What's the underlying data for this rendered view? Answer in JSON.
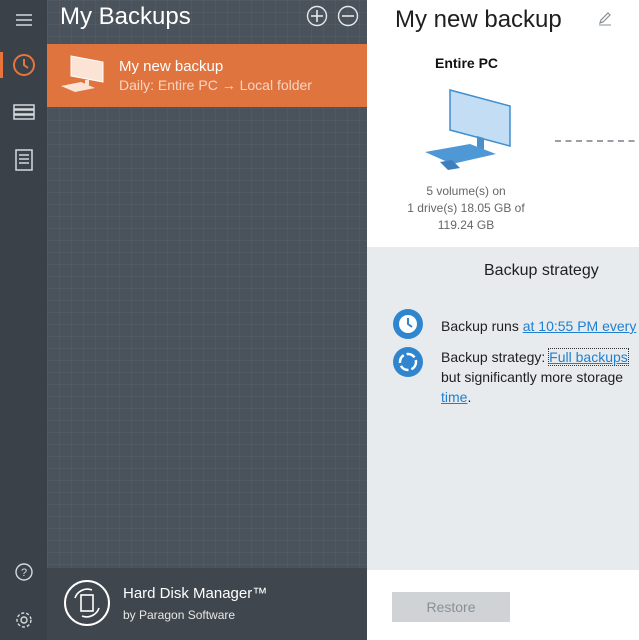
{
  "rail": {
    "icons": [
      "hamburger-menu-icon",
      "clock-history-icon",
      "drive-stack-icon",
      "log-list-icon",
      "help-icon",
      "gear-icon"
    ],
    "accent": "#e8743b"
  },
  "list_panel": {
    "title": "My Backups",
    "items": [
      {
        "name": "My new backup",
        "subtitle": "Daily: Entire PC → Local folder"
      }
    ]
  },
  "brand": {
    "product": "Hard Disk Manager™",
    "vendor": "by Paragon Software"
  },
  "detail": {
    "title": "My new backup",
    "source": {
      "label": "Entire PC",
      "info_line1": "5 volume(s) on",
      "info_line2": "1 drive(s) 18.05 GB of",
      "info_line3": "119.24 GB"
    },
    "strategy": {
      "title": "Backup strategy",
      "schedule_prefix": "Backup runs ",
      "schedule_link": "at 10:55 PM every",
      "strategy_prefix": "Backup strategy: ",
      "strategy_link": "Full backups",
      "strategy_line2": "but significantly more storage",
      "strategy_link2": "time",
      "strategy_suffix": "."
    },
    "restore_label": "Restore"
  },
  "colors": {
    "selected_item": "#e0743f",
    "link": "#1f7fd1",
    "rail_bg": "#3a4148",
    "panel_bg": "#4a535b"
  }
}
